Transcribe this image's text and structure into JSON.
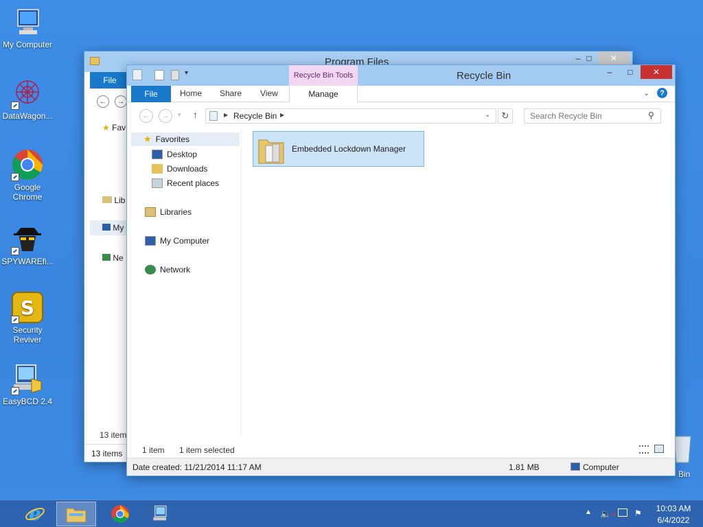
{
  "desktop": {
    "icons": [
      {
        "label": "My Computer"
      },
      {
        "label": "DataWagon..."
      },
      {
        "label": "Google Chrome"
      },
      {
        "label": "SPYWAREfi..."
      },
      {
        "label": "Security Reviver"
      },
      {
        "label": "EasyBCD 2.4"
      }
    ],
    "recycle_partial_label": "Bin"
  },
  "back_window": {
    "title": "Program Files",
    "file_tab": "File",
    "nav_items": [
      "Fav",
      "Lib",
      "My",
      "Ne"
    ],
    "status_items": "13 item",
    "status_items_bottom": "13 items"
  },
  "window": {
    "title": "Recycle Bin",
    "tools_label": "Recycle Bin Tools",
    "tabs": {
      "file": "File",
      "home": "Home",
      "share": "Share",
      "view": "View",
      "manage": "Manage"
    },
    "address": {
      "path": "Recycle Bin"
    },
    "search": {
      "placeholder": "Search Recycle Bin"
    },
    "nav": {
      "favorites": "Favorites",
      "desktop": "Desktop",
      "downloads": "Downloads",
      "recent": "Recent places",
      "libraries": "Libraries",
      "my_computer": "My Computer",
      "network": "Network"
    },
    "files": [
      {
        "name": "Embedded Lockdown Manager"
      }
    ],
    "status": {
      "count": "1 item",
      "selected": "1 item selected"
    },
    "details": {
      "date_created": "Date created: 11/21/2014 11:17 AM",
      "size": "1.81 MB",
      "location": "Computer"
    }
  },
  "taskbar": {
    "time": "10:03 AM",
    "date": "6/4/2022"
  },
  "colors": {
    "accent": "#1979ca",
    "close": "#c7312f",
    "selection": "#cce4f7",
    "tools_tab": "#f2d7f2"
  }
}
